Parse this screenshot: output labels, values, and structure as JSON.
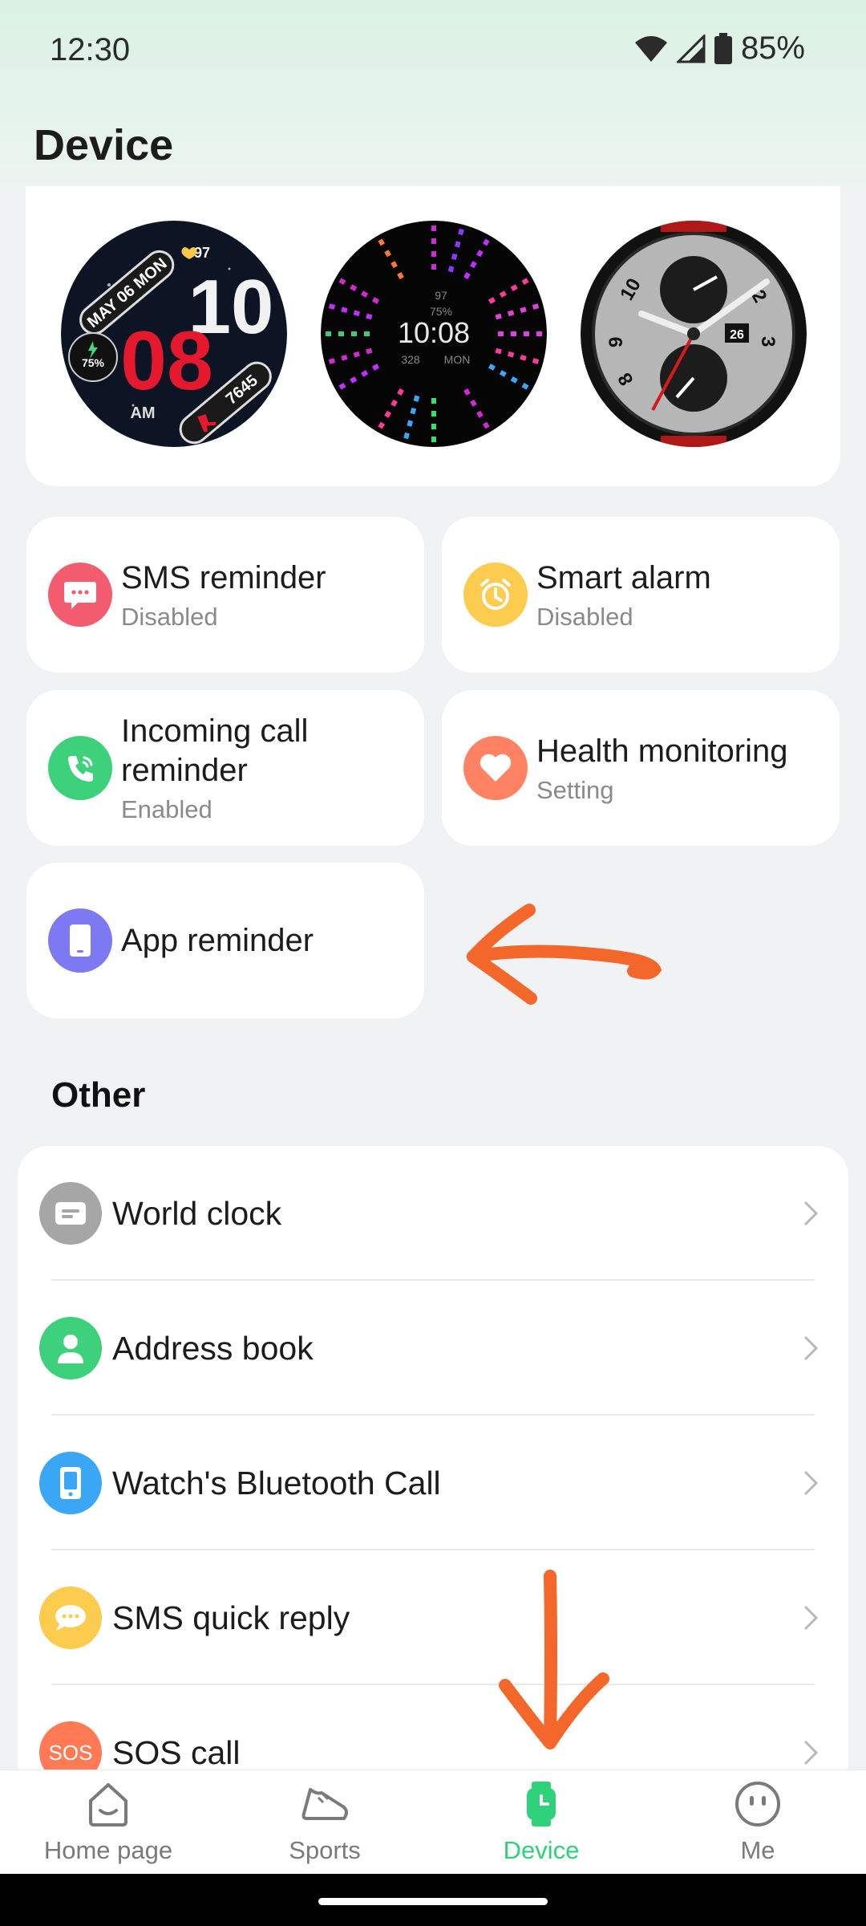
{
  "status_bar": {
    "time": "12:30",
    "battery": "85%"
  },
  "page_title": "Device",
  "watch_faces": [
    {
      "name": "watch-face-digital-red",
      "date": "MAY 06 MON",
      "hour": "10",
      "minute": "08",
      "ampm": "AM",
      "heart": "97",
      "battery": "75%",
      "steps": "7645"
    },
    {
      "name": "watch-face-radial",
      "time": "10:08",
      "heart": "97",
      "battery": "75%",
      "calories": "328",
      "day": "MON"
    },
    {
      "name": "watch-face-analog",
      "date": "26",
      "numerals": [
        "10",
        "2",
        "3",
        "9",
        "8"
      ]
    }
  ],
  "features": [
    {
      "title": "SMS reminder",
      "sub": "Disabled",
      "color": "#f25c6e"
    },
    {
      "title": "Smart alarm",
      "sub": "Disabled",
      "color": "#fccc4f"
    },
    {
      "title": "Incoming call reminder",
      "sub": "Enabled",
      "color": "#3ed17c"
    },
    {
      "title": "Health monitoring",
      "sub": "Setting",
      "color": "#ff8262"
    },
    {
      "title": "App reminder",
      "sub": "",
      "color": "#7d79f2"
    }
  ],
  "other": {
    "heading": "Other",
    "items": [
      {
        "label": "World clock",
        "icon": "world-clock-icon",
        "color": "#a6a6a6"
      },
      {
        "label": "Address book",
        "icon": "address-book-icon",
        "color": "#3ed17c"
      },
      {
        "label": "Watch's Bluetooth Call",
        "icon": "bluetooth-call-icon",
        "color": "#3aa7f5"
      },
      {
        "label": "SMS quick reply",
        "icon": "quick-reply-icon",
        "color": "#fccc4f"
      },
      {
        "label": "SOS call",
        "icon": "sos-icon",
        "icon_text": "SOS",
        "color": "#ff7a55"
      }
    ]
  },
  "nav": {
    "items": [
      {
        "label": "Home page",
        "icon": "home-icon"
      },
      {
        "label": "Sports",
        "icon": "shoe-icon"
      },
      {
        "label": "Device",
        "icon": "watch-icon",
        "active": true
      },
      {
        "label": "Me",
        "icon": "face-icon"
      }
    ],
    "active_color": "#2fd27a"
  },
  "annotation_color": "#f4672a"
}
